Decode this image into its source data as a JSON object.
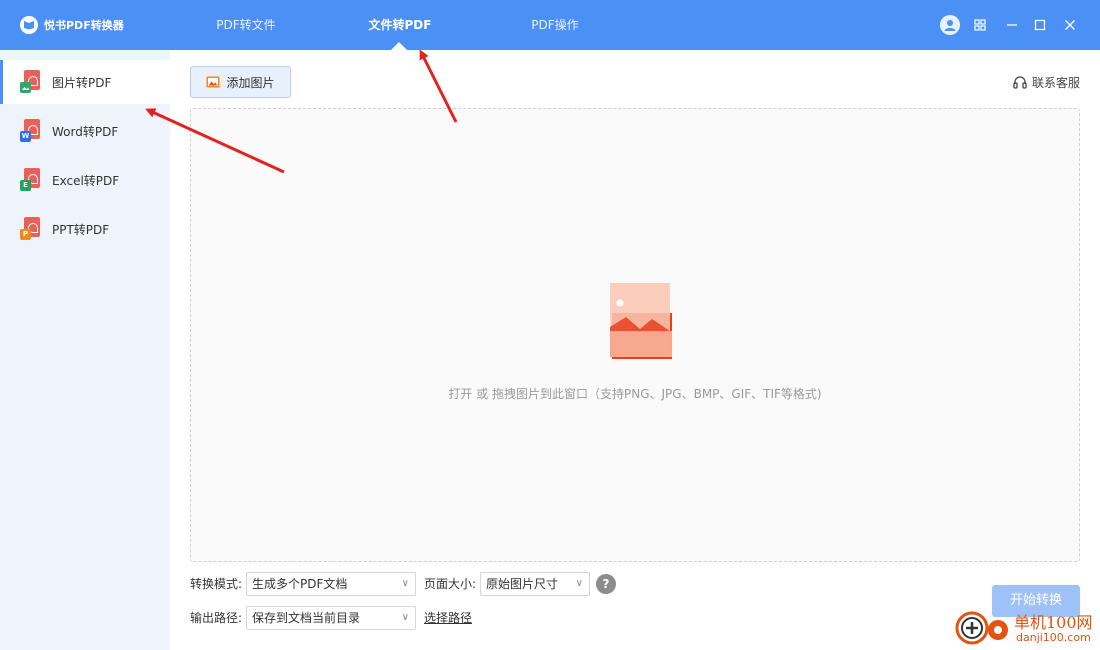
{
  "app": {
    "title": "悦书PDF转换器"
  },
  "nav": {
    "tabs": [
      {
        "label": "PDF转文件"
      },
      {
        "label": "文件转PDF",
        "active": true
      },
      {
        "label": "PDF操作"
      }
    ]
  },
  "sidebar": {
    "items": [
      {
        "label": "图片转PDF",
        "badge_color": "#2fa66b",
        "active": true
      },
      {
        "label": "Word转PDF",
        "badge": "W",
        "badge_color": "#2f6de8"
      },
      {
        "label": "Excel转PDF",
        "badge": "E",
        "badge_color": "#21a35c"
      },
      {
        "label": "PPT转PDF",
        "badge": "P",
        "badge_color": "#f08a1c"
      }
    ]
  },
  "toolbar": {
    "add_label": "添加图片",
    "support_label": "联系客服"
  },
  "dropzone": {
    "hint": "打开 或 拖拽图片到此窗口（支持PNG、JPG、BMP、GIF、TIF等格式)"
  },
  "options": {
    "mode_label": "转换模式:",
    "mode_value": "生成多个PDF文档",
    "page_size_label": "页面大小:",
    "page_size_value": "原始图片尺寸",
    "help": "?",
    "output_label": "输出路径:",
    "output_value": "保存到文档当前目录",
    "choose_path": "选择路径"
  },
  "start_label": "开始转换",
  "watermark": {
    "line1": "单机100网",
    "line2": "danji100.com"
  },
  "colors": {
    "accent": "#4a90f5",
    "arrow": "#e0231f"
  }
}
